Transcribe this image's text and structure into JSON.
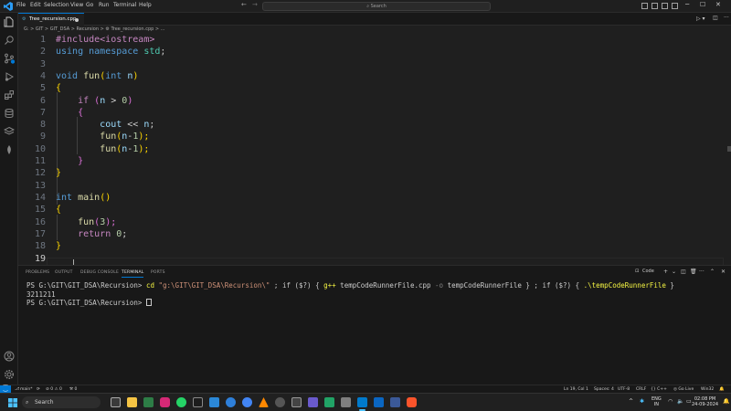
{
  "menu": [
    "File",
    "Edit",
    "Selection",
    "View",
    "Go",
    "Run",
    "Terminal",
    "Help"
  ],
  "search_label": "Search",
  "tab": {
    "label": "Tree_recursion.cpp"
  },
  "breadcrumb": "G: > GIT > GIT_DSA > Recursion > ⚙ Tree_recursion.cpp > ...",
  "line_numbers": [
    "1",
    "2",
    "3",
    "4",
    "5",
    "6",
    "7",
    "8",
    "9",
    "10",
    "11",
    "12",
    "13",
    "14",
    "15",
    "16",
    "17",
    "18",
    "19"
  ],
  "code": {
    "l1_inc": "#include<iostream>",
    "l2_kw1": "using",
    "l2_kw2": "namespace",
    "l2_ns": "std",
    "l2_end": ";",
    "l4_type": "void",
    "l4_fn": "fun",
    "l4_open": "(",
    "l4_type2": "int",
    "l4_var": "n",
    "l4_close": ")",
    "l5_brace": "{",
    "l6_if": "if",
    "l6_open": "(",
    "l6_var": "n",
    "l6_op": " > ",
    "l6_num": "0",
    "l6_close": ")",
    "l7_brace": "{",
    "l8_cout": "cout",
    "l8_op": " << ",
    "l8_var": "n",
    "l8_end": ";",
    "l9_fn": "fun",
    "l9_open": "(",
    "l9_var": "n",
    "l9_op": "-",
    "l9_num": "1",
    "l9_close": ");",
    "l10_fn": "fun",
    "l10_open": "(",
    "l10_var": "n",
    "l10_op": "-",
    "l10_num": "1",
    "l10_close": ");",
    "l11_brace": "}",
    "l12_brace": "}",
    "l14_type": "int",
    "l14_fn": "main",
    "l14_paren": "()",
    "l15_brace": "{",
    "l16_fn": "fun",
    "l16_open": "(",
    "l16_num": "3",
    "l16_close": ");",
    "l17_ret": "return",
    "l17_num": "0",
    "l17_end": ";",
    "l18_brace": "}"
  },
  "panel": {
    "tabs": [
      "PROBLEMS",
      "OUTPUT",
      "DEBUG CONSOLE",
      "TERMINAL",
      "PORTS"
    ],
    "active_tab": "TERMINAL",
    "shell_label": "Code"
  },
  "terminal": {
    "prompt1": "PS G:\\GIT\\GIT_DSA\\Recursion> ",
    "cmd_cd": "cd ",
    "cmd_path": "\"g:\\GIT\\GIT_DSA\\Recursion\\\"",
    "cmd_mid1": " ; if ($?) { ",
    "cmd_gpp": "g++",
    "cmd_mid2": " tempCodeRunnerFile.cpp ",
    "cmd_o": "-o",
    "cmd_mid3": " tempCodeRunnerFile } ; if ($?) { ",
    "cmd_run": ".\\tempCodeRunnerFile",
    "cmd_end": " }",
    "output": "3211211",
    "prompt2": "PS G:\\GIT\\GIT_DSA\\Recursion> "
  },
  "status": {
    "branch": "main*",
    "problems": "⊘ 0 ⚠ 0",
    "ports": "⚒ 0",
    "position": "Ln 19, Col 1",
    "spaces": "Spaces: 4",
    "encoding": "UTF-8",
    "eol": "CRLF",
    "language": "{} C++",
    "golive": "◎ Go Live",
    "platform": "Win32"
  },
  "taskbar": {
    "search": "Search",
    "lang_top": "ENG",
    "lang_bottom": "IN",
    "time": "02:08 PM",
    "date": "24-09-2024"
  },
  "colors": {
    "accent": "#0078d4",
    "editor_bg": "#1f1f1f",
    "keyword": "#569cd6",
    "control": "#c586c0",
    "function": "#dcdcaa",
    "variable": "#9cdcfe",
    "number": "#b5cea8",
    "bracket_gold": "#ffd700",
    "bracket_purple": "#da70d6"
  }
}
